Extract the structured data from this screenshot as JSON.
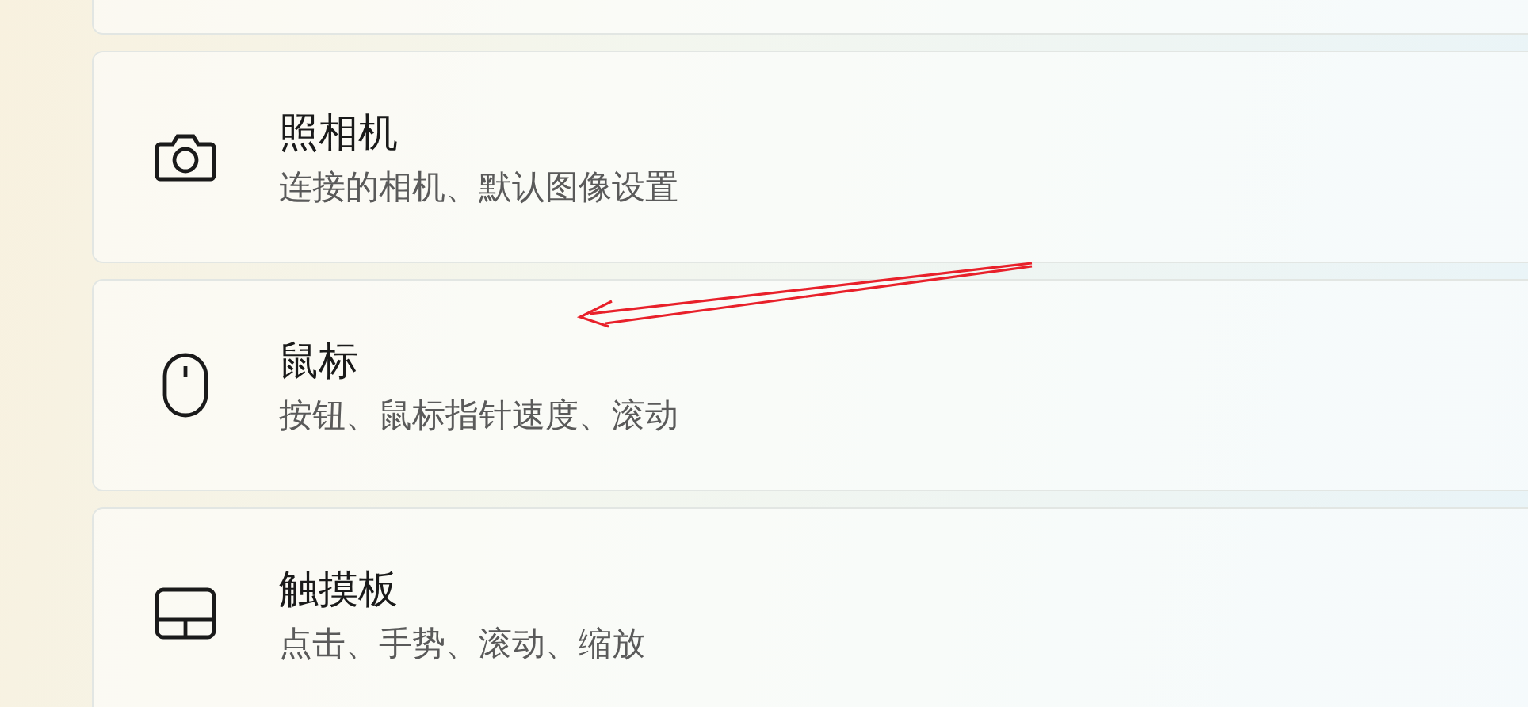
{
  "settings_items": [
    {
      "kind": "camera",
      "title": "照相机",
      "description": "连接的相机、默认图像设置"
    },
    {
      "kind": "mouse",
      "title": "鼠标",
      "description": "按钮、鼠标指针速度、滚动"
    },
    {
      "kind": "touchpad",
      "title": "触摸板",
      "description": "点击、手势、滚动、缩放"
    }
  ]
}
